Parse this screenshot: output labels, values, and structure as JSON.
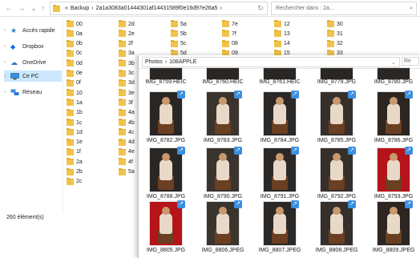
{
  "back_window": {
    "address_segments": [
      "«",
      "Backup",
      "›",
      "2a1a3083a01444301af14431589f0e16d97e26a5",
      "›"
    ],
    "search_placeholder": "Rechercher dans : 2a...",
    "sidebar": [
      {
        "label": "Accès rapide",
        "icon": "star-icon"
      },
      {
        "label": "Dropbox",
        "icon": "dropbox-icon"
      },
      {
        "label": "OneDrive",
        "icon": "cloud-icon"
      },
      {
        "label": "Ce PC",
        "icon": "computer-icon",
        "selected": true
      },
      {
        "label": "Réseau",
        "icon": "network-icon"
      }
    ],
    "status": "260 élément(s)",
    "folders_col1": [
      "00",
      "0a",
      "0b",
      "0c",
      "0d",
      "0e",
      "0f",
      "10",
      "1a",
      "1b",
      "1c",
      "1d",
      "1e",
      "1f",
      "2a",
      "2b",
      "2c"
    ],
    "folders_col2": [
      "2d",
      "2e",
      "2f",
      "3a",
      "3b",
      "3c",
      "3d",
      "3e",
      "3f",
      "4a",
      "4b",
      "4c",
      "4d",
      "4e",
      "4f",
      "5a"
    ],
    "folders_col3": [
      "5a",
      "5b",
      "5c",
      "5d"
    ],
    "folders_col4": [
      "7e",
      "7f",
      "08",
      "09"
    ],
    "folders_col5": [
      "12",
      "13",
      "14",
      "15"
    ],
    "folders_col6": [
      "30",
      "31",
      "32",
      "33"
    ]
  },
  "front_window": {
    "breadcrumb": [
      "Photos",
      "›",
      "108APPLE"
    ],
    "search_stub": "Re",
    "top_labels": [
      "IMG_8759.HEIC",
      "IMG_8760.HEIC",
      "IMG_8761.HEIC",
      "IMG_8779.JPG",
      "IMG_8780.JPG"
    ],
    "rows": [
      [
        "IMG_8782.JPG",
        "IMG_8783.JPG",
        "IMG_8784.JPG",
        "IMG_8785.JPG",
        "IMG_8786.JPG"
      ],
      [
        "IMG_8788.JPG",
        "IMG_8790.JPG",
        "IMG_8791.JPG",
        "IMG_8792.JPG",
        "IMG_8793.JPG"
      ],
      [
        "IMG_8805.JPG",
        "IMG_8806.JPEG",
        "IMG_8807.JPEG",
        "IMG_8808.JPEG",
        "IMG_8809.JPEG"
      ]
    ],
    "badge_glyph": "↗"
  }
}
